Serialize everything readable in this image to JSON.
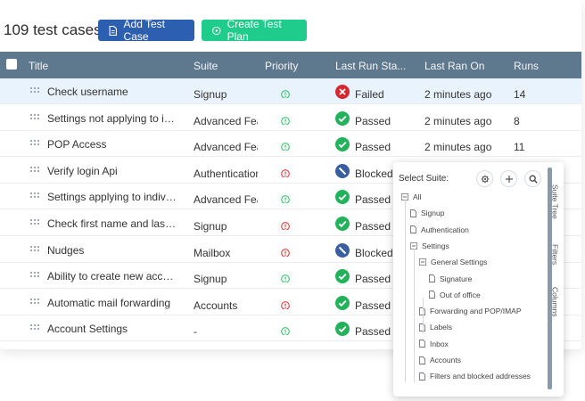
{
  "header": {
    "case_count": "109 test cases",
    "add_label": "Add Test Case",
    "plan_label": "Create Test Plan"
  },
  "table": {
    "columns": [
      "Title",
      "Suite",
      "Priority",
      "Last Run Sta...",
      "Last Ran On",
      "Runs"
    ],
    "rows": [
      {
        "title": "Check username",
        "suite": "Signup",
        "priority": "normal",
        "status": "Failed",
        "ran": "2 minutes ago",
        "runs": "14"
      },
      {
        "title": "Settings not applying to indi...",
        "suite": "Advanced Feat",
        "priority": "normal",
        "status": "Passed",
        "ran": "2 minutes ago",
        "runs": "8"
      },
      {
        "title": "POP Access",
        "suite": "Advanced Feat",
        "priority": "normal",
        "status": "Passed",
        "ran": "2 minutes ago",
        "runs": "11"
      },
      {
        "title": "Verify login Api",
        "suite": "Authentication",
        "priority": "high",
        "status": "Blocked",
        "ran": "",
        "runs": ""
      },
      {
        "title": "Settings applying to individu...",
        "suite": "Advanced Feat",
        "priority": "normal",
        "status": "Passed",
        "ran": "",
        "runs": ""
      },
      {
        "title": "Check first name and last na...",
        "suite": "Signup",
        "priority": "high",
        "status": "Passed",
        "ran": "",
        "runs": ""
      },
      {
        "title": "Nudges",
        "suite": "Mailbox",
        "priority": "high",
        "status": "Blocked",
        "ran": "",
        "runs": ""
      },
      {
        "title": "Ability to create new account",
        "suite": "Signup",
        "priority": "normal",
        "status": "Passed",
        "ran": "",
        "runs": ""
      },
      {
        "title": "Automatic mail forwarding",
        "suite": "Accounts",
        "priority": "high",
        "status": "Passed",
        "ran": "",
        "runs": ""
      },
      {
        "title": "Account Settings",
        "suite": "-",
        "priority": "normal",
        "status": "Passed",
        "ran": "",
        "runs": ""
      }
    ]
  },
  "suite_panel": {
    "label": "Select Suite:",
    "buttons": [
      "gear-icon",
      "plus-icon",
      "search-icon"
    ],
    "tree": [
      {
        "label": "All",
        "level": 0,
        "kind": "minus"
      },
      {
        "label": "Signup",
        "level": 1,
        "kind": "file"
      },
      {
        "label": "Authentication",
        "level": 1,
        "kind": "file"
      },
      {
        "label": "Settings",
        "level": 1,
        "kind": "minus"
      },
      {
        "label": "General Settings",
        "level": 2,
        "kind": "minus"
      },
      {
        "label": "Signature",
        "level": 3,
        "kind": "file"
      },
      {
        "label": "Out of office",
        "level": 3,
        "kind": "file"
      },
      {
        "label": "Forwarding and POP/IMAP",
        "level": 2,
        "kind": "file"
      },
      {
        "label": "Labels",
        "level": 2,
        "kind": "file"
      },
      {
        "label": "Inbox",
        "level": 2,
        "kind": "file"
      },
      {
        "label": "Accounts",
        "level": 2,
        "kind": "file"
      },
      {
        "label": "Filters and blocked addresses",
        "level": 2,
        "kind": "file"
      }
    ],
    "tabs": [
      "Suite Tree",
      "Filters",
      "Columns"
    ]
  },
  "colors": {
    "header_bar": "#5e788e",
    "primary": "#2d5fb0",
    "success": "#1fcc8c",
    "passed": "#21b25a",
    "failed": "#d8282f",
    "blocked": "#3a5fa0",
    "prio_normal": "#34c36a",
    "prio_high": "#e23b3b"
  }
}
